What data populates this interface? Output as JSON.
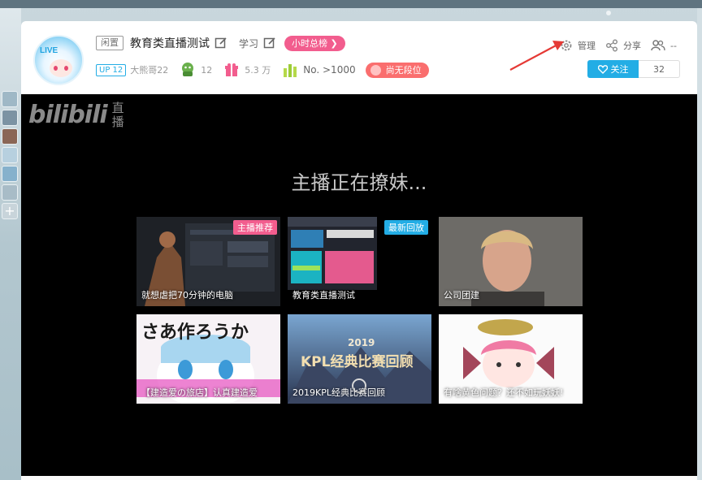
{
  "header": {
    "avatar_text": "LIVE",
    "room_tag": "闲置",
    "room_title": "教育类直播测试",
    "category": "学习",
    "hour_rank": "小时总榜",
    "up_level": "UP 12",
    "username": "大熊哥22",
    "stat_1": "12",
    "stat_2": "5.3 万",
    "rank": "No. >1000",
    "no_rank_label": "尚无段位",
    "manage_label": "管理",
    "share_label": "分享",
    "more_label": "--",
    "follow_label": "关注",
    "follow_count": "32"
  },
  "player": {
    "logo_text": "bilibili",
    "logo_sub": "直播",
    "status_text": "主播正在撩妹...",
    "recommendations": [
      {
        "caption": "就想虐把70分钟的电脑",
        "badge": "主播推荐"
      },
      {
        "caption": "教育类直播测试",
        "badge": "最新回放"
      },
      {
        "caption": "公司团建",
        "badge": ""
      },
      {
        "caption": "【建造爱の旅店】认真建造爱",
        "badge": "",
        "overlay": "さあ作ろうか"
      },
      {
        "caption": "2019KPL经典比赛回顾",
        "badge": "",
        "overlay": "KPL经典比赛回顾",
        "overlay_year": "2019"
      },
      {
        "caption": "有啥黄色问题？还不如玩妖妖!",
        "badge": ""
      }
    ]
  },
  "colors": {
    "brand_blue": "#23ade5",
    "brand_pink": "#f25d8e",
    "player_bg": "#000000"
  }
}
